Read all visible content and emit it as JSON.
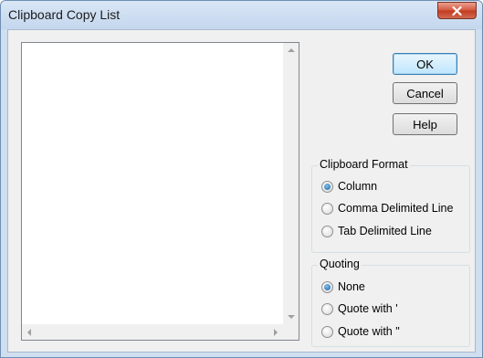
{
  "window": {
    "title": "Clipboard Copy List"
  },
  "buttons": {
    "ok": "OK",
    "cancel": "Cancel",
    "help": "Help"
  },
  "clipboard_format": {
    "label": "Clipboard Format",
    "options": [
      {
        "label": "Column",
        "checked": true
      },
      {
        "label": "Comma Delimited Line",
        "checked": false
      },
      {
        "label": "Tab Delimited Line",
        "checked": false
      }
    ]
  },
  "quoting": {
    "label": "Quoting",
    "options": [
      {
        "label": "None",
        "checked": true
      },
      {
        "label": "Quote with '",
        "checked": false
      },
      {
        "label": "Quote with \"",
        "checked": false
      }
    ]
  },
  "icons": {
    "close": "close-icon"
  },
  "colors": {
    "close_button": "#c9472d",
    "default_button_border": "#3c7fb1",
    "radio_selected": "#1a5fa5"
  }
}
